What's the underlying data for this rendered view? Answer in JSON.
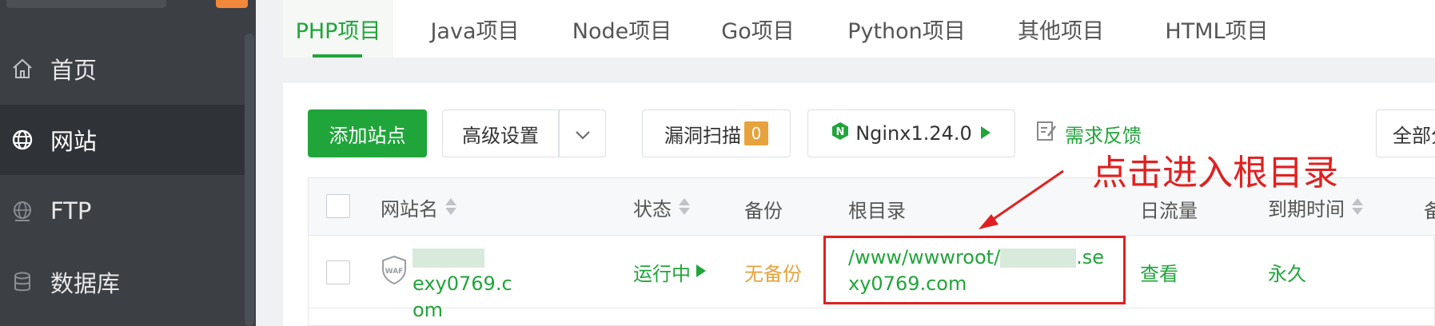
{
  "sidebar": {
    "items": [
      {
        "label": "首页",
        "icon": "home-icon",
        "active": false
      },
      {
        "label": "网站",
        "icon": "globe-icon",
        "active": true
      },
      {
        "label": "FTP",
        "icon": "ftp-globe-icon",
        "active": false
      },
      {
        "label": "数据库",
        "icon": "database-icon",
        "active": false
      }
    ]
  },
  "tabs": [
    {
      "label": "PHP项目",
      "active": true
    },
    {
      "label": "Java项目"
    },
    {
      "label": "Node项目"
    },
    {
      "label": "Go项目"
    },
    {
      "label": "Python项目"
    },
    {
      "label": "其他项目"
    },
    {
      "label": "HTML项目"
    }
  ],
  "toolbar": {
    "add_site": "添加站点",
    "advanced_settings": "高级设置",
    "vuln_scan": "漏洞扫描",
    "vuln_count": "0",
    "nginx": "Nginx1.24.0",
    "feedback": "需求反馈",
    "all_filter": "全部分"
  },
  "table": {
    "headers": {
      "site_name": "网站名",
      "status": "状态",
      "backup": "备份",
      "root_dir": "根目录",
      "daily_traffic": "日流量",
      "expiry": "到期时间",
      "remark": "备"
    },
    "rows": [
      {
        "waf": "WAF",
        "site_name_line1_suffix": "exy0769.c",
        "site_name_line2": "om",
        "status": "运行中",
        "backup": "无备份",
        "root_line1_prefix": "/www/wwwroot/",
        "root_line1_suffix": ".se",
        "root_line2": "xy0769.com",
        "traffic": "查看",
        "expiry": "永久"
      }
    ]
  },
  "annotation": {
    "text": "点击进入根目录",
    "color": "#e02020"
  },
  "colors": {
    "accent": "#20a53a",
    "warning": "#e6a23c",
    "sidebar_bg": "#3c3f44"
  }
}
